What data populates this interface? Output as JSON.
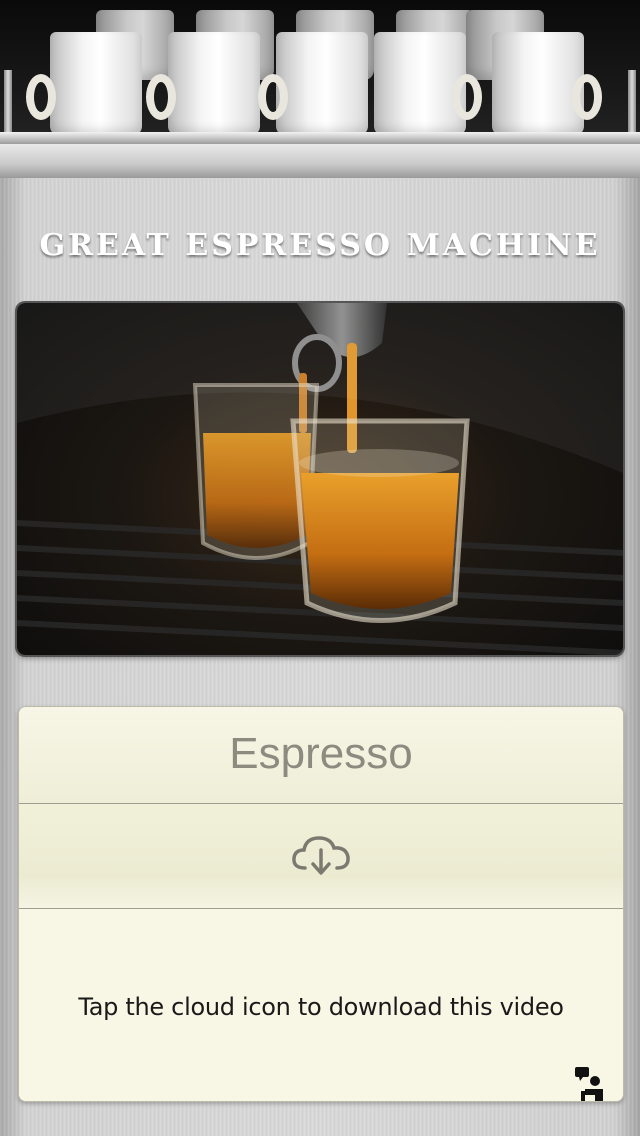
{
  "header": {
    "title": "GREAT ESPRESSO MACHINE"
  },
  "video": {
    "thumbnail_icon": "espresso-shots-image"
  },
  "card": {
    "title": "Espresso",
    "download_icon": "cloud-download-icon",
    "hint": "Tap the cloud icon to download this video",
    "help_icon": "barista-help-icon"
  },
  "colors": {
    "card_bg": "#f6f4e1",
    "title_text": "#ffffff",
    "card_title_text": "#8d8b80"
  }
}
